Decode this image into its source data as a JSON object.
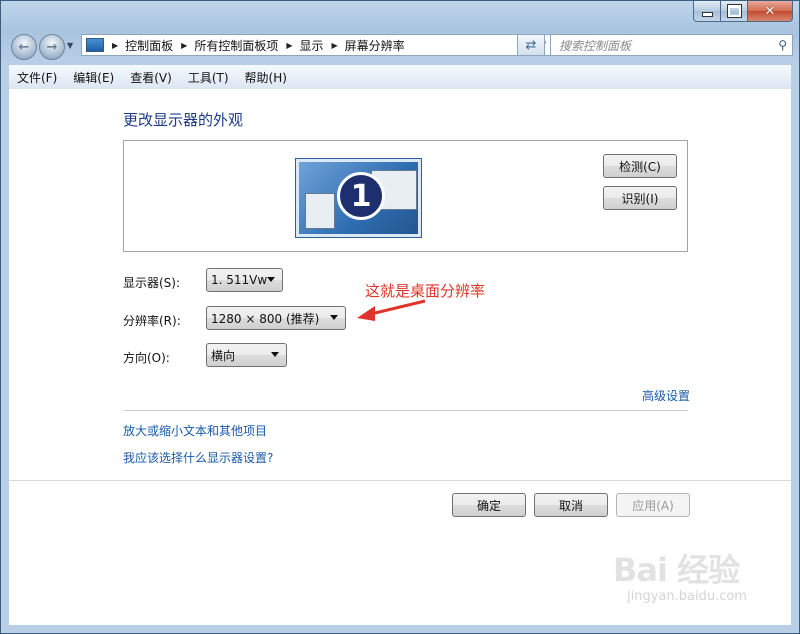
{
  "window": {
    "caption_buttons": {
      "minimize": "minimize-icon",
      "maximize": "maximize-icon",
      "close": "close-icon"
    }
  },
  "nav": {
    "breadcrumbs": [
      "控制面板",
      "所有控制面板项",
      "显示",
      "屏幕分辨率"
    ],
    "search_placeholder": "搜索控制面板"
  },
  "menu": [
    "文件(F)",
    "编辑(E)",
    "查看(V)",
    "工具(T)",
    "帮助(H)"
  ],
  "main": {
    "heading": "更改显示器的外观",
    "monitor_number": "1",
    "detect_label": "检测(C)",
    "identify_label": "识别(I)",
    "display_label": "显示器(S):",
    "display_value": "1. 511Vw",
    "resolution_label": "分辨率(R):",
    "resolution_value": "1280 × 800 (推荐)",
    "orientation_label": "方向(O):",
    "orientation_value": "横向",
    "annotation": "这就是桌面分辨率",
    "advanced_link": "高级设置",
    "link_text_size": "放大或缩小文本和其他项目",
    "link_which_settings": "我应该选择什么显示器设置?",
    "ok_label": "确定",
    "cancel_label": "取消",
    "apply_label": "应用(A)"
  },
  "watermark": {
    "logo": "Bai  经验",
    "url": "jingyan.baidu.com"
  },
  "colors": {
    "link": "#1b5aa8",
    "heading": "#1e3b8a",
    "annotation": "#e0342a"
  }
}
